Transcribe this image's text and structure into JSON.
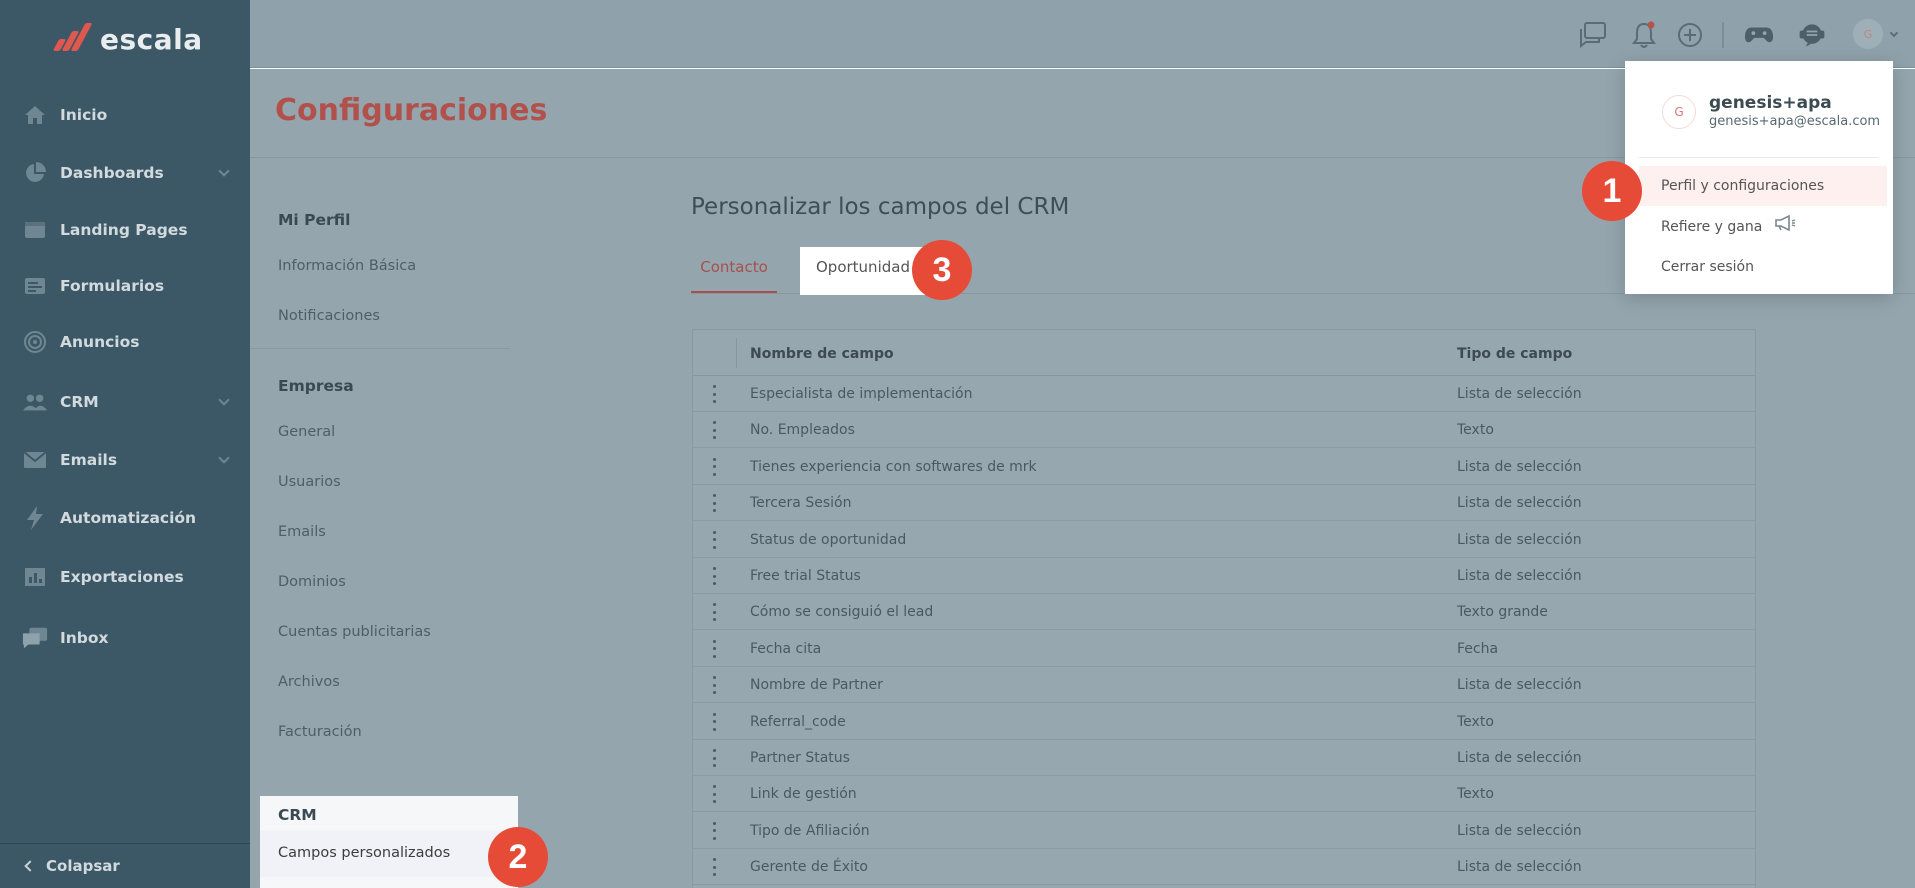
{
  "logo": {
    "text": "escala"
  },
  "sidebar": {
    "items": [
      {
        "label": "Inicio",
        "icon": "home-icon"
      },
      {
        "label": "Dashboards",
        "icon": "pie-chart-icon",
        "chevron": true
      },
      {
        "label": "Landing Pages",
        "icon": "window-icon"
      },
      {
        "label": "Formularios",
        "icon": "form-icon"
      },
      {
        "label": "Anuncios",
        "icon": "target-icon"
      },
      {
        "label": "CRM",
        "icon": "users-icon",
        "chevron": true
      },
      {
        "label": "Emails",
        "icon": "mail-icon",
        "chevron": true
      },
      {
        "label": "Automatización",
        "icon": "lightning-icon"
      },
      {
        "label": "Exportaciones",
        "icon": "export-chart-icon"
      },
      {
        "label": "Inbox",
        "icon": "inbox-chat-icon"
      }
    ],
    "collapse_label": "Colapsar"
  },
  "topbar": {
    "avatar_initial": "G"
  },
  "page": {
    "title": "Configuraciones"
  },
  "settings_nav": {
    "mi_perfil": {
      "title": "Mi Perfil",
      "items": [
        "Información Básica",
        "Notificaciones"
      ]
    },
    "empresa": {
      "title": "Empresa",
      "items": [
        "General",
        "Usuarios",
        "Emails",
        "Dominios",
        "Cuentas publicitarias",
        "Archivos",
        "Facturación"
      ]
    },
    "crm": {
      "title": "CRM",
      "items": [
        "Campos personalizados"
      ]
    }
  },
  "content": {
    "title": "Personalizar los campos del CRM",
    "tabs": {
      "contacto": "Contacto",
      "oportunidad": "Oportunidad"
    },
    "table": {
      "headers": {
        "name": "Nombre de campo",
        "type": "Tipo de campo"
      },
      "rows": [
        {
          "name": "Especialista de implementación",
          "type": "Lista de selección"
        },
        {
          "name": "No. Empleados",
          "type": "Texto"
        },
        {
          "name": "Tienes experiencia con softwares de mrk",
          "type": "Lista de selección"
        },
        {
          "name": "Tercera Sesión",
          "type": "Lista de selección"
        },
        {
          "name": "Status de oportunidad",
          "type": "Lista de selección"
        },
        {
          "name": "Free trial Status",
          "type": "Lista de selección"
        },
        {
          "name": "Cómo se consiguió el lead",
          "type": "Texto grande"
        },
        {
          "name": "Fecha cita",
          "type": "Fecha"
        },
        {
          "name": "Nombre de Partner",
          "type": "Lista de selección"
        },
        {
          "name": "Referral_code",
          "type": "Texto"
        },
        {
          "name": "Partner Status",
          "type": "Lista de selección"
        },
        {
          "name": "Link de gestión",
          "type": "Texto"
        },
        {
          "name": "Tipo de Afiliación",
          "type": "Lista de selección"
        },
        {
          "name": "Gerente de Éxito",
          "type": "Lista de selección"
        }
      ]
    }
  },
  "dropdown": {
    "avatar_initial": "G",
    "name": "genesis+apa",
    "email": "genesis+apa@escala.com",
    "items": [
      "Perfil y configuraciones",
      "Refiere y gana",
      "Cerrar sesión"
    ]
  },
  "steps": [
    "1",
    "2",
    "3"
  ],
  "colors": {
    "sidebar_bg": "#3c5866",
    "accent_red": "#e64b38",
    "title_red": "#b0514c",
    "overlay": "#94a5ae"
  }
}
